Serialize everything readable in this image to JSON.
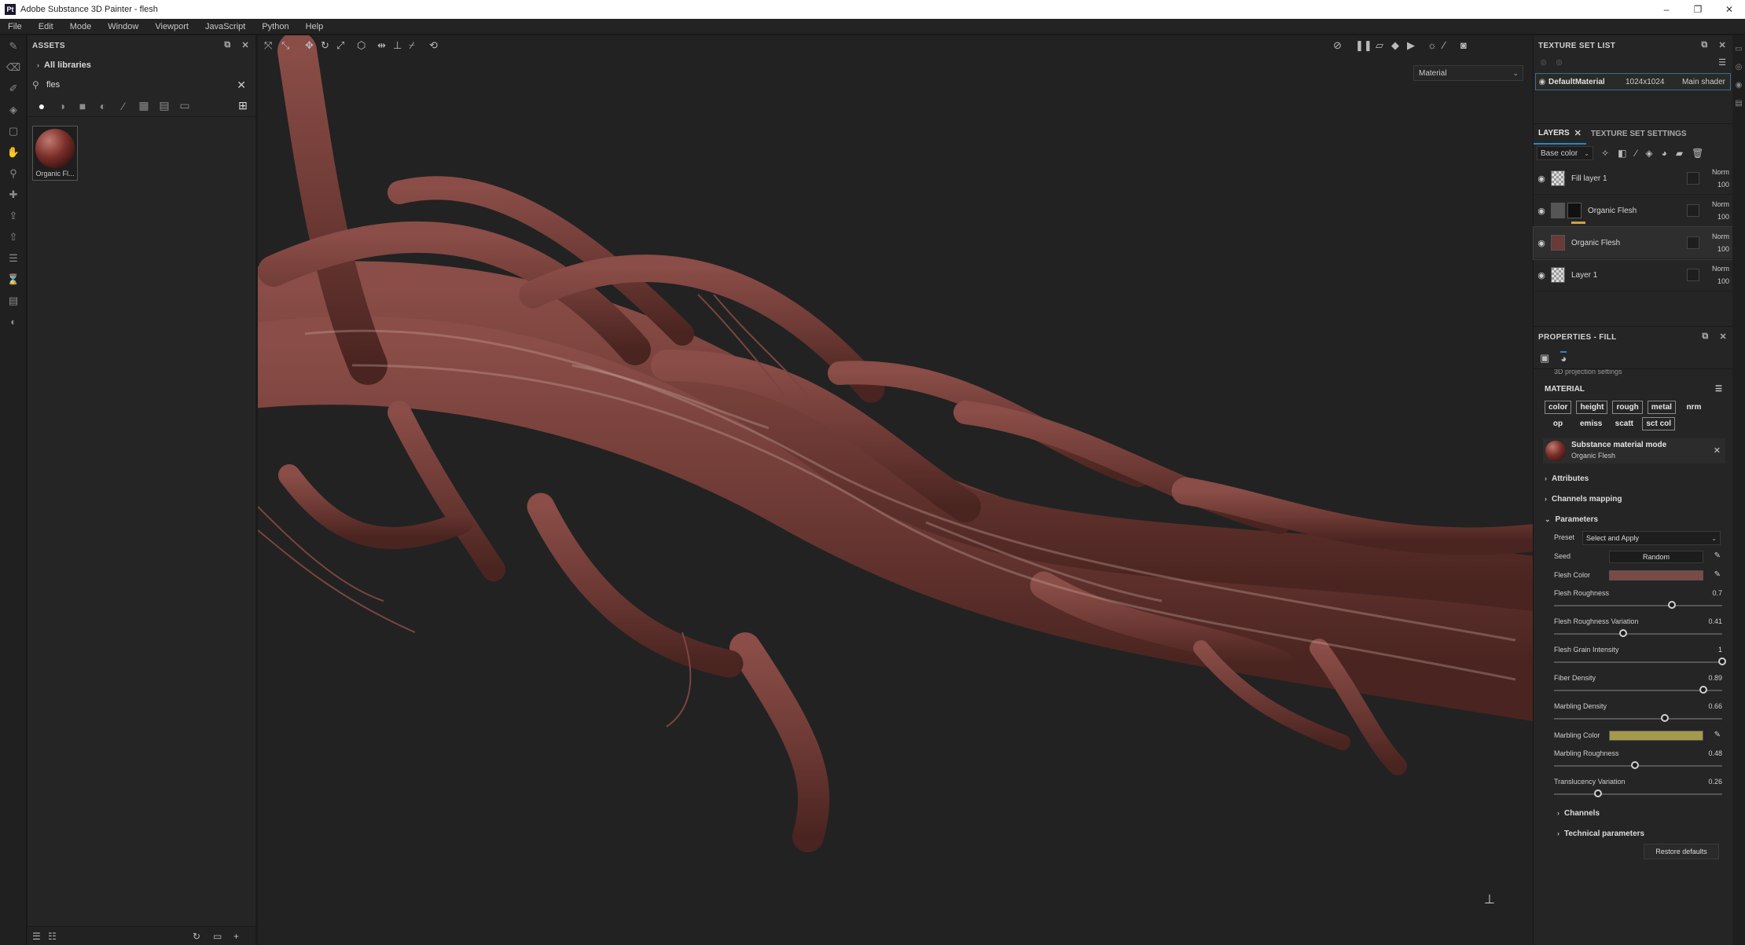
{
  "window": {
    "title": "Adobe Substance 3D Painter - flesh",
    "app_icon": "Pt",
    "controls": [
      "–",
      "❐",
      "✕"
    ]
  },
  "menu": [
    "File",
    "Edit",
    "Mode",
    "Window",
    "Viewport",
    "JavaScript",
    "Python",
    "Help"
  ],
  "assets": {
    "header": "ASSETS",
    "libraries": "All libraries",
    "search_value": "fles",
    "asset_label": "Organic Fl..."
  },
  "viewport": {
    "view_mode": "Material"
  },
  "texture_set_list": {
    "header": "TEXTURE SET LIST",
    "row": {
      "name": "DefaultMaterial",
      "resolution": "1024x1024",
      "shader": "Main shader"
    }
  },
  "layers_panel": {
    "tab_layers": "LAYERS",
    "tab_settings": "TEXTURE SET SETTINGS",
    "channel": "Base color",
    "layers": [
      {
        "name": "Fill layer 1",
        "blend": "Norm",
        "opacity": "100"
      },
      {
        "name": "Organic Flesh",
        "blend": "Norm",
        "opacity": "100"
      },
      {
        "name": "Organic Flesh",
        "blend": "Norm",
        "opacity": "100"
      },
      {
        "name": "Layer 1",
        "blend": "Norm",
        "opacity": "100"
      }
    ]
  },
  "properties": {
    "header": "PROPERTIES - FILL",
    "cut_text": "3D projection settings",
    "material_title": "MATERIAL",
    "channels_row1": [
      "color",
      "height",
      "rough",
      "metal",
      "nrm"
    ],
    "channels_row2": [
      "op",
      "emiss",
      "scatt",
      "sct col"
    ],
    "submaterial": {
      "mode": "Substance material mode",
      "name": "Organic Flesh"
    },
    "groups": {
      "attributes": "Attributes",
      "channels_mapping": "Channels mapping",
      "parameters": "Parameters"
    },
    "preset": {
      "label": "Preset",
      "value": "Select and Apply"
    },
    "seed": {
      "label": "Seed",
      "value": "Random"
    },
    "flesh_color": {
      "label": "Flesh Color",
      "color": "#7a4a46"
    },
    "sliders": [
      {
        "label": "Flesh Roughness",
        "value": "0.7",
        "fraction": 0.7
      },
      {
        "label": "Flesh Roughness Variation",
        "value": "0.41",
        "fraction": 0.41
      },
      {
        "label": "Flesh Grain Intensity",
        "value": "1",
        "fraction": 1.0
      },
      {
        "label": "Fiber Density",
        "value": "0.89",
        "fraction": 0.89
      }
    ],
    "marbling_density": {
      "label": "Marbling Density",
      "value": "0.66",
      "fraction": 0.66
    },
    "marbling_color": {
      "label": "Marbling Color",
      "color": "#a49a4c"
    },
    "sliders2": [
      {
        "label": "Marbling Roughness",
        "value": "0.48",
        "fraction": 0.48
      },
      {
        "label": "Translucency Variation",
        "value": "0.26",
        "fraction": 0.26
      }
    ],
    "sub_groups": {
      "channels": "Channels",
      "technical": "Technical parameters"
    },
    "restore_label": "Restore defaults"
  }
}
